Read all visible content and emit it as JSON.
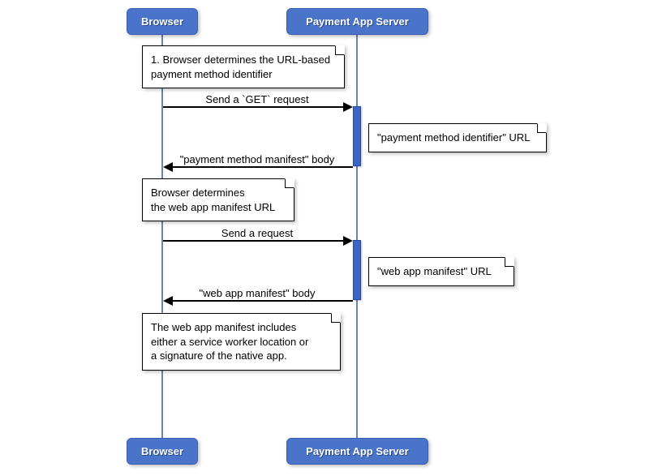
{
  "participants": {
    "browser": "Browser",
    "server": "Payment App Server"
  },
  "notes": {
    "n1_line1": "1. Browser determines the URL-based",
    "n1_line2": "payment method identifier",
    "n2_line1": "\"payment method identifier\" URL",
    "n3_line1": "Browser determines",
    "n3_line2": "the web app manifest URL",
    "n4_line1": "\"web app manifest\" URL",
    "n5_line1": "The web app manifest includes",
    "n5_line2": "either a service worker location or",
    "n5_line3": "a signature of the native app."
  },
  "messages": {
    "m1": "Send a `GET` request",
    "m2": "\"payment method manifest\" body",
    "m3": "Send a request",
    "m4": "\"web app manifest\" body"
  },
  "chart_data": {
    "type": "sequence-diagram",
    "participants": [
      "Browser",
      "Payment App Server"
    ],
    "steps": [
      {
        "kind": "note",
        "over": "Browser",
        "text": "1. Browser determines the URL-based payment method identifier"
      },
      {
        "kind": "message",
        "from": "Browser",
        "to": "Payment App Server",
        "text": "Send a `GET` request"
      },
      {
        "kind": "note",
        "over": "Payment App Server",
        "text": "\"payment method identifier\" URL"
      },
      {
        "kind": "message",
        "from": "Payment App Server",
        "to": "Browser",
        "text": "\"payment method manifest\" body"
      },
      {
        "kind": "note",
        "over": "Browser",
        "text": "Browser determines the web app manifest URL"
      },
      {
        "kind": "message",
        "from": "Browser",
        "to": "Payment App Server",
        "text": "Send a request"
      },
      {
        "kind": "note",
        "over": "Payment App Server",
        "text": "\"web app manifest\" URL"
      },
      {
        "kind": "message",
        "from": "Payment App Server",
        "to": "Browser",
        "text": "\"web app manifest\" body"
      },
      {
        "kind": "note",
        "over": "Browser",
        "text": "The web app manifest includes either a service worker location or a signature of the native app."
      }
    ]
  }
}
